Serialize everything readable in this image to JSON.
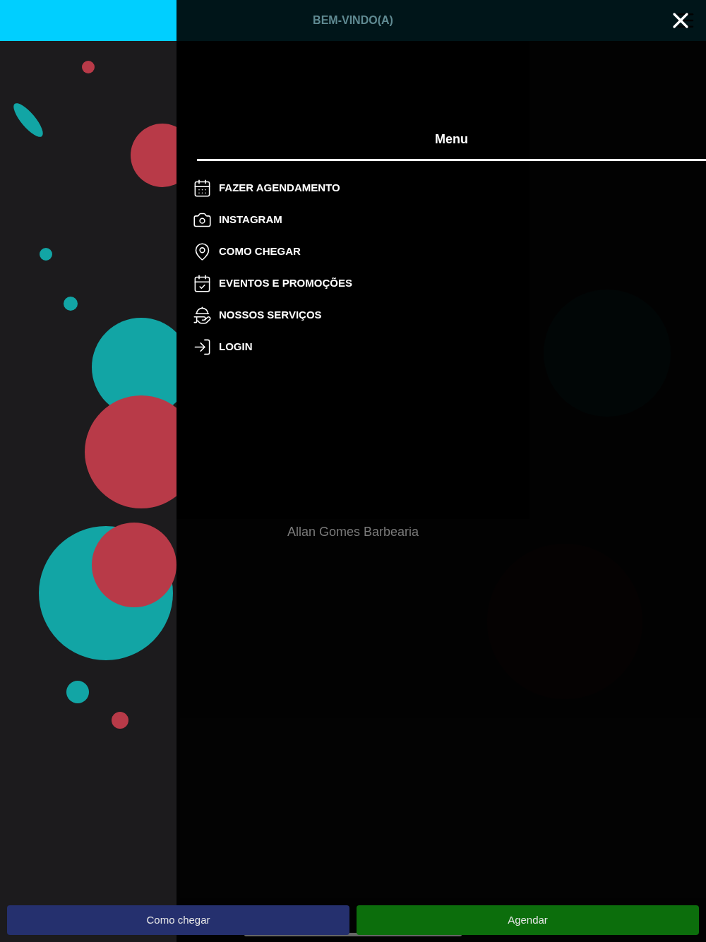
{
  "header": {
    "title": "BEM-VINDO(A)"
  },
  "background_title": "Allan Gomes Barbearia",
  "menu": {
    "title": "Menu",
    "items": [
      {
        "kind": "schedule",
        "label": "FAZER AGENDAMENTO"
      },
      {
        "kind": "instagram",
        "label": "INSTAGRAM"
      },
      {
        "kind": "location",
        "label": "COMO CHEGAR"
      },
      {
        "kind": "events",
        "label": "EVENTOS E PROMOÇÕES"
      },
      {
        "kind": "services",
        "label": "NOSSOS SERVIÇOS"
      },
      {
        "kind": "login",
        "label": "LOGIN"
      }
    ]
  },
  "bottom_buttons": [
    {
      "label": "Como chegar",
      "color": "#25306e"
    },
    {
      "label": "Agendar",
      "color": "#0c6e0c"
    }
  ]
}
